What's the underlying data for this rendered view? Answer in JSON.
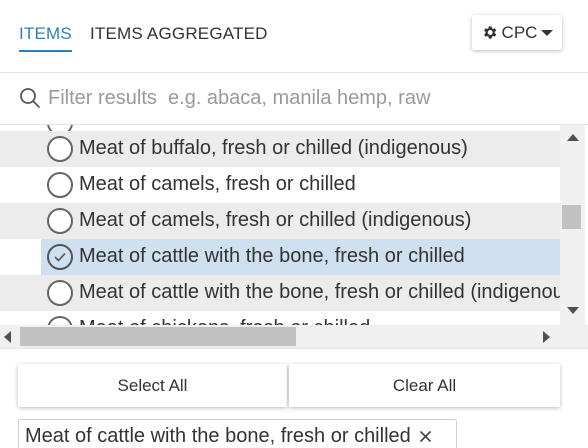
{
  "tabs": [
    {
      "label": "ITEMS",
      "active": true
    },
    {
      "label": "ITEMS AGGREGATED",
      "active": false
    }
  ],
  "classification_button": {
    "label": "CPC",
    "icon": "gear-icon",
    "caret": "caret-down-icon"
  },
  "filter": {
    "placeholder": "Filter results  e.g. abaca, manila hemp, raw",
    "value": "",
    "icon": "search-icon"
  },
  "list": {
    "items": [
      {
        "label": "",
        "selected": false,
        "striped": false
      },
      {
        "label": "Meat of buffalo, fresh or chilled (indigenous)",
        "selected": false,
        "striped": true
      },
      {
        "label": "Meat of camels, fresh or chilled",
        "selected": false,
        "striped": false
      },
      {
        "label": "Meat of camels, fresh or chilled (indigenous)",
        "selected": false,
        "striped": true
      },
      {
        "label": "Meat of cattle with the bone, fresh or chilled",
        "selected": true,
        "striped": false
      },
      {
        "label": "Meat of cattle with the bone, fresh or chilled (indigenous)",
        "selected": false,
        "striped": true
      },
      {
        "label": "Meat of chickens, fresh or chilled",
        "selected": false,
        "striped": false
      }
    ]
  },
  "actions": {
    "select_all": "Select All",
    "clear_all": "Clear All"
  },
  "selected_chips": [
    {
      "label": "Meat of cattle with the bone, fresh or chilled",
      "remove_icon": "close-icon"
    }
  ],
  "colors": {
    "accent": "#2d7fc1",
    "selected_row": "#cfe0f1",
    "stripe": "#ececec"
  }
}
